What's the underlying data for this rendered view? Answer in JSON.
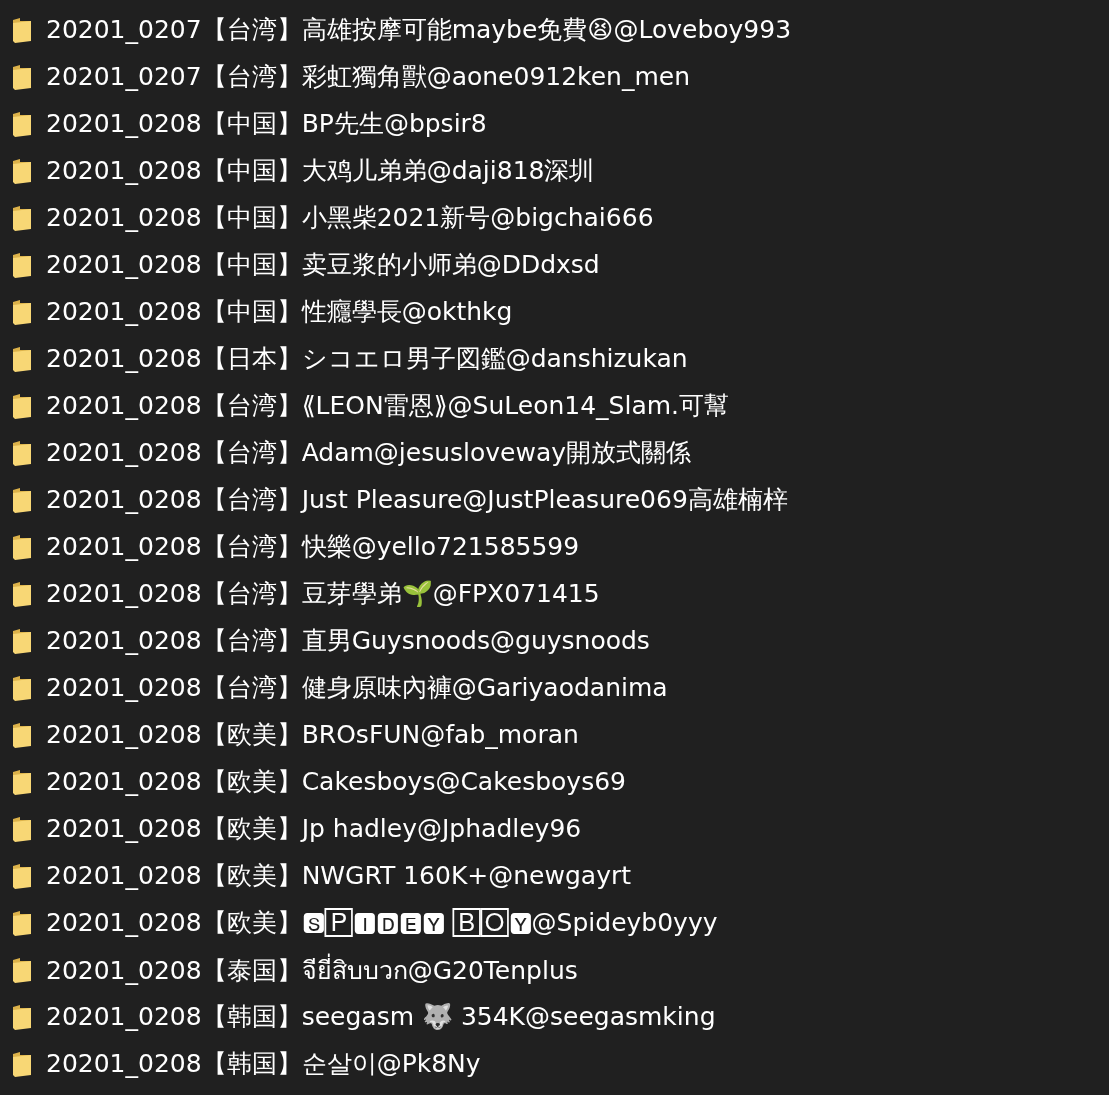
{
  "folders": [
    {
      "name": "20201_0207【台湾】高雄按摩可能maybe免費😫@Loveboy993"
    },
    {
      "name": "20201_0207【台湾】彩虹獨角獸@aone0912ken_men"
    },
    {
      "name": "20201_0208【中国】BP先生@bpsir8"
    },
    {
      "name": "20201_0208【中国】大鸡儿弟弟@daji818深圳"
    },
    {
      "name": "20201_0208【中国】小黑柴2021新号@bigchai666"
    },
    {
      "name": "20201_0208【中国】卖豆浆的小师弟@DDdxsd"
    },
    {
      "name": "20201_0208【中国】性癮學長@okthkg"
    },
    {
      "name": "20201_0208【日本】シコエロ男子図鑑@danshizukan"
    },
    {
      "name": "20201_0208【台湾】⟪LEON雷恩⟫@SuLeon14_Slam.可幫"
    },
    {
      "name": "20201_0208【台湾】Adam@jesusloveway開放式關係"
    },
    {
      "name": "20201_0208【台湾】Just Pleasure@JustPleasure069高雄楠梓"
    },
    {
      "name": "20201_0208【台湾】快樂@yello721585599"
    },
    {
      "name": "20201_0208【台湾】豆芽學弟🌱@FPX071415"
    },
    {
      "name": "20201_0208【台湾】直男Guysnoods@guysnoods"
    },
    {
      "name": "20201_0208【台湾】健身原味內褲@Gariyaodanima"
    },
    {
      "name": "20201_0208【欧美】BROsFUN@fab_moran"
    },
    {
      "name": "20201_0208【欧美】Cakesboys@Cakesboys69"
    },
    {
      "name": "20201_0208【欧美】Jp hadley@Jphadley96"
    },
    {
      "name": "20201_0208【欧美】NWGRT 160K+@newgayrt"
    },
    {
      "name": "20201_0208【欧美】🆂🄿🅸🅳🅴🆈 🄱🄾🆈@Spideyb0yyy"
    },
    {
      "name": "20201_0208【泰国】จียี่สิบบวก@G20Tenplus"
    },
    {
      "name": "20201_0208【韩国】seegasm 🐺 354K@seegasmking"
    },
    {
      "name": "20201_0208【韩国】순살이@Pk8Ny"
    }
  ]
}
